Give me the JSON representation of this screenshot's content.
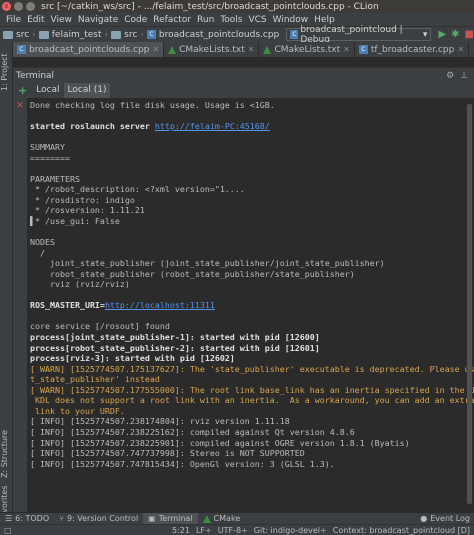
{
  "window": {
    "title": "src [~/catkin_ws/src] - .../felaim_test/src/broadcast_pointclouds.cpp - CLion",
    "close_glyph": "x"
  },
  "menu": [
    "File",
    "Edit",
    "View",
    "Navigate",
    "Code",
    "Refactor",
    "Run",
    "Tools",
    "VCS",
    "Window",
    "Help"
  ],
  "navbar": {
    "crumbs": [
      "src",
      "felaim_test",
      "src",
      "broadcast_pointclouds.cpp"
    ],
    "run_config": "broadcast_pointcloud | Debug"
  },
  "left_strip": {
    "project": "1: Project",
    "structure": "Z: Structure",
    "favorites": "2: Favorites"
  },
  "editor_tabs": [
    {
      "label": "broadcast_pointclouds.cpp",
      "icon": "cpp-file-icon"
    },
    {
      "label": "CMakeLists.txt",
      "icon": "cmake-icon"
    },
    {
      "label": "CMakeLists.txt",
      "icon": "cmake-icon"
    },
    {
      "label": "tf_broadcaster.cpp",
      "icon": "cpp-file-icon"
    }
  ],
  "terminal_panel": {
    "title": "Terminal",
    "tabs": [
      "Local",
      "Local (1)"
    ],
    "add_glyph": "+"
  },
  "terminal_lines": [
    {
      "text": "Done checking log file disk usage. Usage is <1GB.",
      "style": "normal"
    },
    {
      "text": "",
      "style": "normal"
    },
    {
      "text": "started roslaunch server ",
      "style": "bold",
      "link": "http://felaim-PC:45168/"
    },
    {
      "text": "",
      "style": "normal"
    },
    {
      "text": "SUMMARY",
      "style": "normal"
    },
    {
      "text": "========",
      "style": "normal"
    },
    {
      "text": "",
      "style": "normal"
    },
    {
      "text": "PARAMETERS",
      "style": "normal"
    },
    {
      "text": " * /robot_description: <?xml version=\"1....",
      "style": "normal"
    },
    {
      "text": " * /rosdistro: indigo",
      "style": "normal"
    },
    {
      "text": " * /rosversion: 1.11.21",
      "style": "normal"
    },
    {
      "text": "▌* /use_gui: False",
      "style": "normal"
    },
    {
      "text": "",
      "style": "normal"
    },
    {
      "text": "NODES",
      "style": "normal"
    },
    {
      "text": "  /",
      "style": "normal"
    },
    {
      "text": "    joint_state_publisher (joint_state_publisher/joint_state_publisher)",
      "style": "normal"
    },
    {
      "text": "    robot_state_publisher (robot_state_publisher/state_publisher)",
      "style": "normal"
    },
    {
      "text": "    rviz (rviz/rviz)",
      "style": "normal"
    },
    {
      "text": "",
      "style": "normal"
    },
    {
      "text": "ROS_MASTER_URI=",
      "style": "bold",
      "link": "http://localhost:11311"
    },
    {
      "text": "",
      "style": "normal"
    },
    {
      "text": "core service [/rosout] found",
      "style": "normal"
    },
    {
      "text": "process[joint_state_publisher-1]: started with pid [12600]",
      "style": "bold"
    },
    {
      "text": "process[robot_state_publisher-2]: started with pid [12601]",
      "style": "bold"
    },
    {
      "text": "process[rviz-3]: started with pid [12602]",
      "style": "bold"
    },
    {
      "text": "[ WARN] [1525774507.175137627]: The 'state_publisher' executable is deprecated. Please use 'robot",
      "style": "warn"
    },
    {
      "text": "t_state_publisher' instead",
      "style": "warn"
    },
    {
      "text": "[ WARN] [1525774507.177555000]: The root link base_link has an inertia specified in the URDF, but",
      "style": "warn"
    },
    {
      "text": " KDL does not support a root link with an inertia.  As a workaround, you can add an extra dummy",
      "style": "warn"
    },
    {
      "text": " link to your URDF.",
      "style": "warn"
    },
    {
      "text": "[ INFO] [1525774507.238174804]: rviz version 1.11.18",
      "style": "normal"
    },
    {
      "text": "[ INFO] [1525774507.238225162]: compiled against Qt version 4.8.6",
      "style": "normal"
    },
    {
      "text": "[ INFO] [1525774507.238225901]: compiled against OGRE version 1.8.1 (Byatis)",
      "style": "normal"
    },
    {
      "text": "[ INFO] [1525774507.747737998]: Stereo is NOT SUPPORTED",
      "style": "normal"
    },
    {
      "text": "[ INFO] [1525774507.747815434]: OpenGl version: 3 (GLSL 1.3).",
      "style": "normal"
    },
    {
      "text": "",
      "style": "normal"
    }
  ],
  "bottom_tabs": [
    "6: TODO",
    "9: Version Control",
    "Terminal",
    "CMake"
  ],
  "event_log": "Event Log",
  "status": {
    "position": "5:21",
    "line_sep": "LF÷",
    "encoding": "UTF-8÷",
    "git": "Git: indigo-devel÷",
    "context": "Context: broadcast_pointcloud [D]"
  }
}
